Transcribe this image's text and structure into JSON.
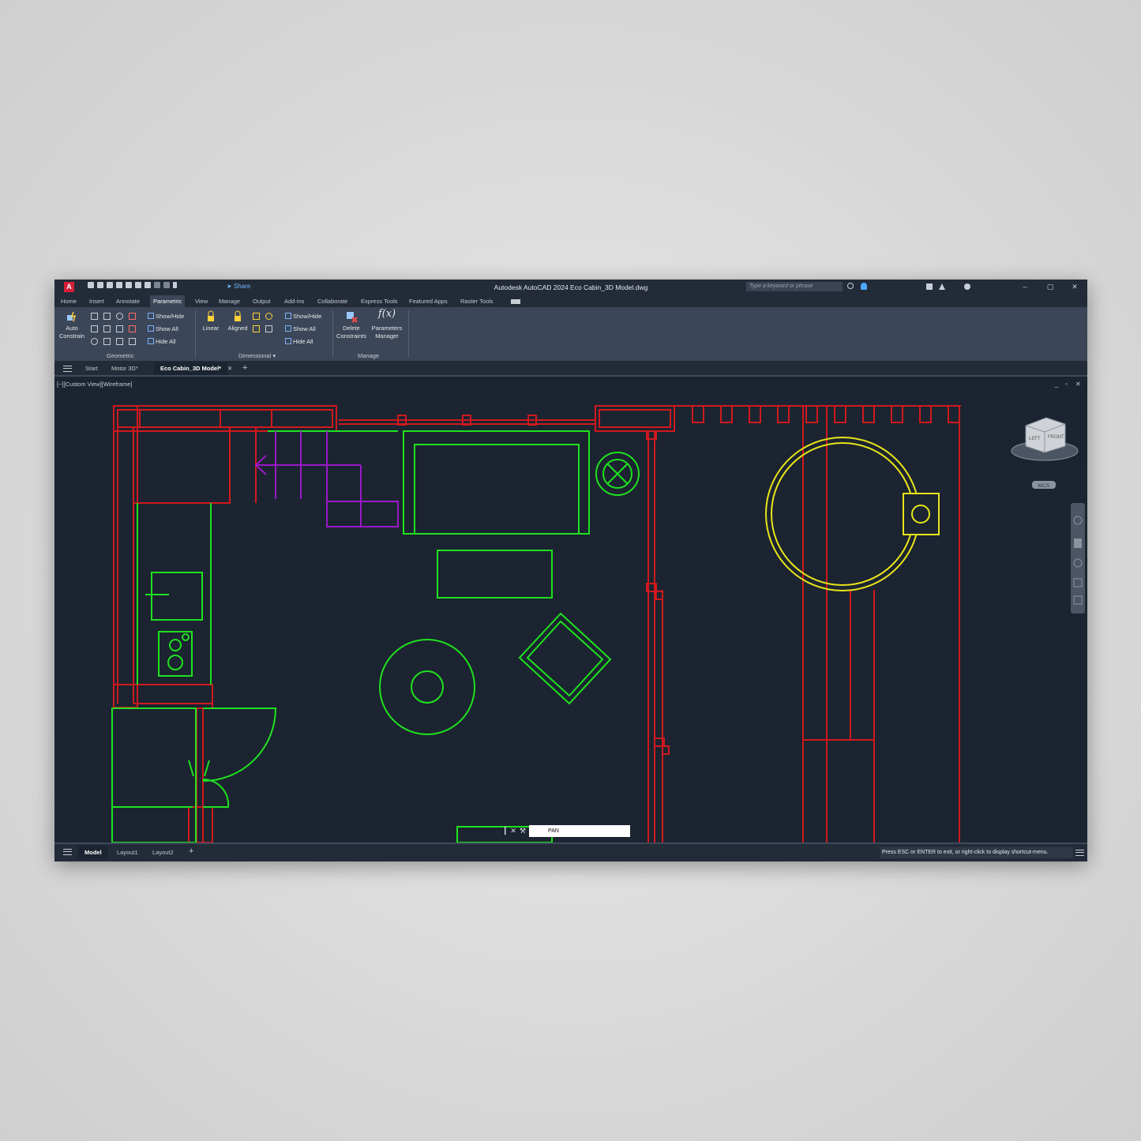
{
  "window": {
    "title": "Autodesk AutoCAD 2024   Eco Cabin_3D Model.dwg",
    "app_icon_letter": "A",
    "share_label": "Share",
    "search_placeholder": "Type a keyword or phrase",
    "minimize": "–",
    "restore": "▢",
    "close": "✕"
  },
  "menu_tabs": [
    "Home",
    "Insert",
    "Annotate",
    "Parametric",
    "View",
    "Manage",
    "Output",
    "Add-ins",
    "Collaborate",
    "Express Tools",
    "Featured Apps",
    "Raster Tools"
  ],
  "active_tab": "Parametric",
  "ribbon": {
    "auto_constrain": "Auto Constrain",
    "geometric_show_hide": "Show/Hide",
    "geometric_show_all": "Show All",
    "geometric_hide_all": "Hide All",
    "geometric_panel": "Geometric",
    "linear": "Linear",
    "aligned": "Aligned",
    "dim_show_hide": "Show/Hide",
    "dim_show_all": "Show All",
    "dim_hide_all": "Hide All",
    "dimensional_panel": "Dimensional",
    "delete_constraints": "Delete Constraints",
    "parameters_manager": "Parameters Manager",
    "fx": "f(x)",
    "manage_panel": "Manage"
  },
  "file_tabs": [
    "Start",
    "Motor 3D*",
    "Eco Cabin_3D Model*"
  ],
  "active_file": "Eco Cabin_3D Model*",
  "viewport": {
    "label": "[−][Custom View][Wireframe]",
    "viewcube_left": "LEFT",
    "viewcube_front": "FRONT",
    "wcs": "WCS",
    "minimize": "_",
    "restore": "▫",
    "close": "✕"
  },
  "command_line": {
    "value": "PAN"
  },
  "layout_tabs": [
    "Model",
    "Layout1",
    "Layout2"
  ],
  "active_layout": "Model",
  "status_message": "Press ESC or ENTER to exit, or right-click to display shortcut-menu.",
  "colors": {
    "walls": "#d0191e",
    "furniture": "#1fe21f",
    "stairs": "#9b18c9",
    "table": "#e8e51a",
    "accent": "#d51f3a"
  }
}
